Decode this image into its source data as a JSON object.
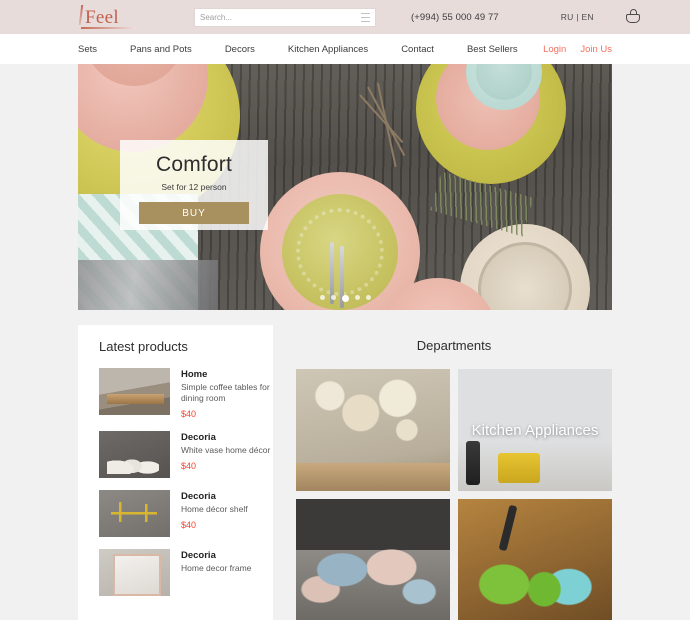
{
  "topbar": {
    "logo_text": "Feel",
    "search": {
      "placeholder": "Search...",
      "value": "",
      "icon": "search-icon"
    },
    "phone": "(+994) 55 000 49 77",
    "language": "RU | EN",
    "cart_icon": "basket-icon"
  },
  "nav": {
    "items": [
      {
        "label": "Sets"
      },
      {
        "label": "Pans and Pots"
      },
      {
        "label": "Decors"
      },
      {
        "label": "Kitchen Appliances"
      },
      {
        "label": "Contact"
      },
      {
        "label": "Best Sellers"
      }
    ],
    "login_label": "Login",
    "join_label": "Join Us",
    "accent_color": "#f4705e"
  },
  "hero": {
    "title": "Comfort",
    "subtitle": "Set for 12 person",
    "button_label": "BUY",
    "button_color": "#a8915f",
    "dots": 5,
    "active_dot": 3
  },
  "latest": {
    "title": "Latest products",
    "products": [
      {
        "name": "Home",
        "desc": "Simple coffee tables for dining room",
        "price": "$40"
      },
      {
        "name": "Decoria",
        "desc": "White vase home décor",
        "price": "$40"
      },
      {
        "name": "Decoria",
        "desc": "Home décor shelf",
        "price": "$40"
      },
      {
        "name": "Decoria",
        "desc": "Home decor frame",
        "price": ""
      }
    ],
    "price_color": "#f4442e"
  },
  "departments": {
    "title": "Departments",
    "tiles": [
      {
        "label": ""
      },
      {
        "label": "Kitchen Appliances"
      },
      {
        "label": ""
      },
      {
        "label": ""
      }
    ]
  },
  "colors": {
    "topbar_bg": "#e8dcdb",
    "nav_bg": "#ffffff",
    "page_bg": "#f2f1f1",
    "logo": "#c0604f"
  }
}
